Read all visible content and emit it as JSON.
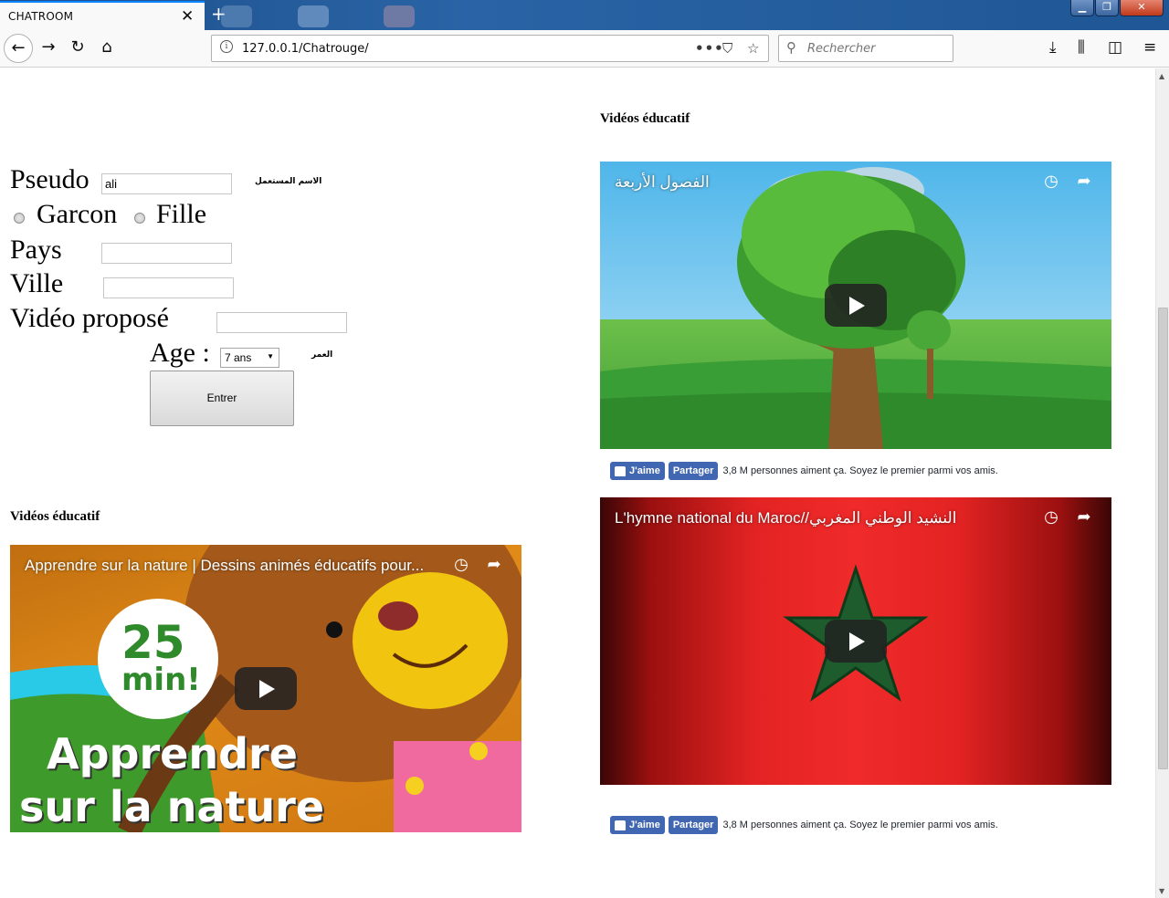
{
  "browser": {
    "tab_title": "CHATROOM",
    "tab_close": "✕",
    "new_tab": "+",
    "url": "127.0.0.1/Chatrouge/",
    "search_placeholder": "Rechercher",
    "icons": [
      "back-icon",
      "forward-icon",
      "reload-icon",
      "home-icon",
      "info-icon",
      "page-actions-icon",
      "pocket-icon",
      "bookmark-star-icon",
      "search-icon",
      "download-icon",
      "library-icon",
      "sidebar-icon",
      "menu-icon"
    ]
  },
  "form": {
    "pseudo_label": "Pseudo",
    "pseudo_value": "ali",
    "pseudo_arabic": "الاسم المستعمل",
    "garcon_label": "Garcon",
    "fille_label": "Fille",
    "pays_label": "Pays",
    "ville_label": "Ville",
    "video_label": "Vidéo proposé",
    "age_label": "Age :",
    "age_value": "7 ans",
    "age_arabic": "العمر",
    "submit_label": "Entrer"
  },
  "sections": {
    "left_heading": "Vidéos éducatif",
    "right_heading": "Vidéos éducatif"
  },
  "videos": [
    {
      "title": "الفصول الأربعة"
    },
    {
      "title": "L'hymne national du Maroc//النشيد الوطني المغربي"
    },
    {
      "title": "Apprendre sur la nature | Dessins animés éducatifs pour...",
      "thumb_badge_number": "25",
      "thumb_badge_unit": "min!",
      "thumb_caption_1": "Apprendre",
      "thumb_caption_2": "sur la nature"
    }
  ],
  "facebook": {
    "like_label": "J'aime",
    "share_label": "Partager",
    "count_text": "3,8 M personnes aiment ça. Soyez le premier parmi vos amis."
  },
  "colors": {
    "fb_blue": "#4267b2",
    "firefox_accent": "#0a84ff",
    "titlebar": "#2a64a6"
  }
}
